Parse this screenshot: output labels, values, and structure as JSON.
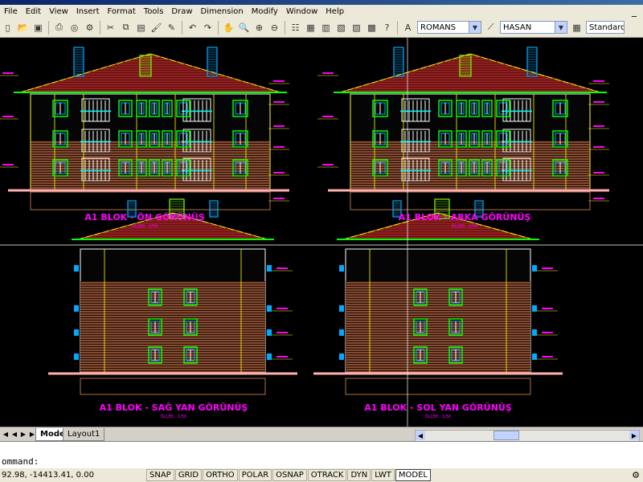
{
  "menus": [
    "File",
    "Edit",
    "View",
    "Insert",
    "Format",
    "Tools",
    "Draw",
    "Dimension",
    "Modify",
    "Window",
    "Help"
  ],
  "minimize": "_",
  "toolbar": {
    "text_style": "ROMANS",
    "dim_style": "HASAN",
    "table_style": "Standard"
  },
  "drawing": {
    "views": [
      {
        "title": "A1 BLOK - ÖN GÖRÜNÜŞ",
        "scale": "ÖLÇEK : 1/50"
      },
      {
        "title": "A1 BLOK - ARKA GÖRÜNÜŞ",
        "scale": "ÖLÇEK : 1/50"
      },
      {
        "title": "A1 BLOK - SAĞ YAN GÖRÜNÜŞ",
        "scale": "ÖLÇEK : 1/50"
      },
      {
        "title": "A1 BLOK - SOL YAN GÖRÜNÜŞ",
        "scale": "ÖLÇEK : 1/50"
      }
    ]
  },
  "layout_tabs": {
    "model": "Model",
    "layout": "Layout1"
  },
  "command": {
    "prompt": "ommand:"
  },
  "status": {
    "coords": "92.98, -14413.41, 0.00",
    "buttons": [
      "SNAP",
      "GRID",
      "ORTHO",
      "POLAR",
      "OSNAP",
      "OTRACK",
      "DYN",
      "LWT",
      "MODEL"
    ]
  },
  "colors": {
    "background": "#000000",
    "title_text": "#ff00ff",
    "roof": "#8b1a1a",
    "walls": "#d98c5f",
    "windows": "#00ff00",
    "crosshair": "#ffffff"
  }
}
